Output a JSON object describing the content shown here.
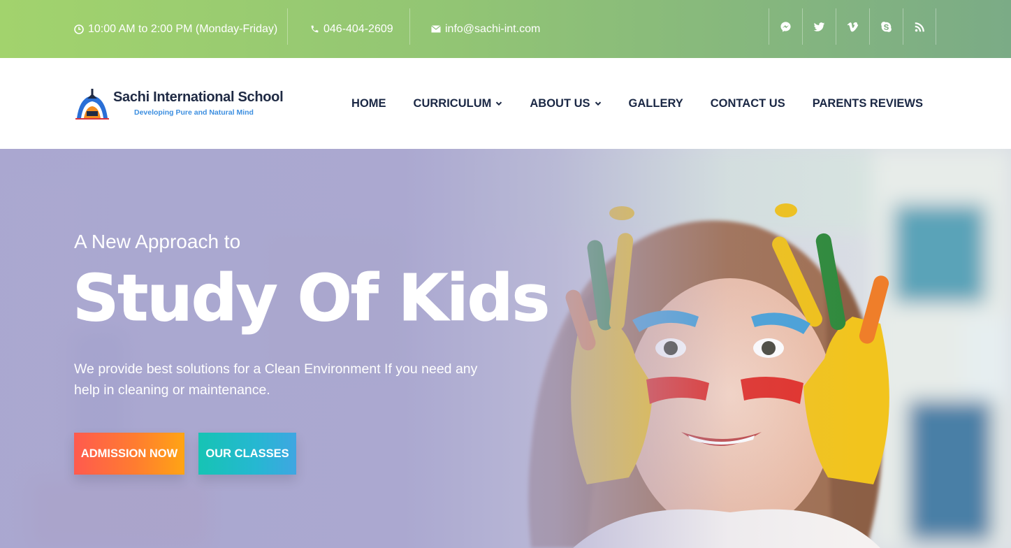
{
  "topbar": {
    "hours": "10:00 AM to 2:00 PM (Monday-Friday)",
    "phone": "046-404-2609",
    "email": "info@sachi-int.com",
    "socials": [
      "messenger-icon",
      "twitter-icon",
      "vimeo-icon",
      "skype-icon",
      "rss-icon"
    ]
  },
  "header": {
    "logo_name": "Sachi International School",
    "logo_tagline": "Developing Pure and Natural Mind",
    "nav": [
      {
        "label": "HOME",
        "dropdown": false
      },
      {
        "label": "CURRICULUM",
        "dropdown": true
      },
      {
        "label": "ABOUT US",
        "dropdown": true
      },
      {
        "label": "GALLERY",
        "dropdown": false
      },
      {
        "label": "CONTACT US",
        "dropdown": false
      },
      {
        "label": "PARENTS REVIEWS",
        "dropdown": false
      }
    ]
  },
  "hero": {
    "subtitle": "A New Approach to",
    "title": "Study Of Kids",
    "text": "We provide best solutions for a Clean Environment If you need any help in cleaning or maintenance.",
    "primary_button": "ADMISSION NOW",
    "secondary_button": "OUR CLASSES"
  },
  "colors": {
    "topbar_start": "#a2d36d",
    "topbar_end": "#7bab86",
    "nav_text": "#1a2744",
    "hero_overlay": "#a8a5cf",
    "admission_start": "#ff5a4e",
    "admission_end": "#ffa414",
    "classes_start": "#16c4b4",
    "classes_end": "#3fa6e2"
  }
}
